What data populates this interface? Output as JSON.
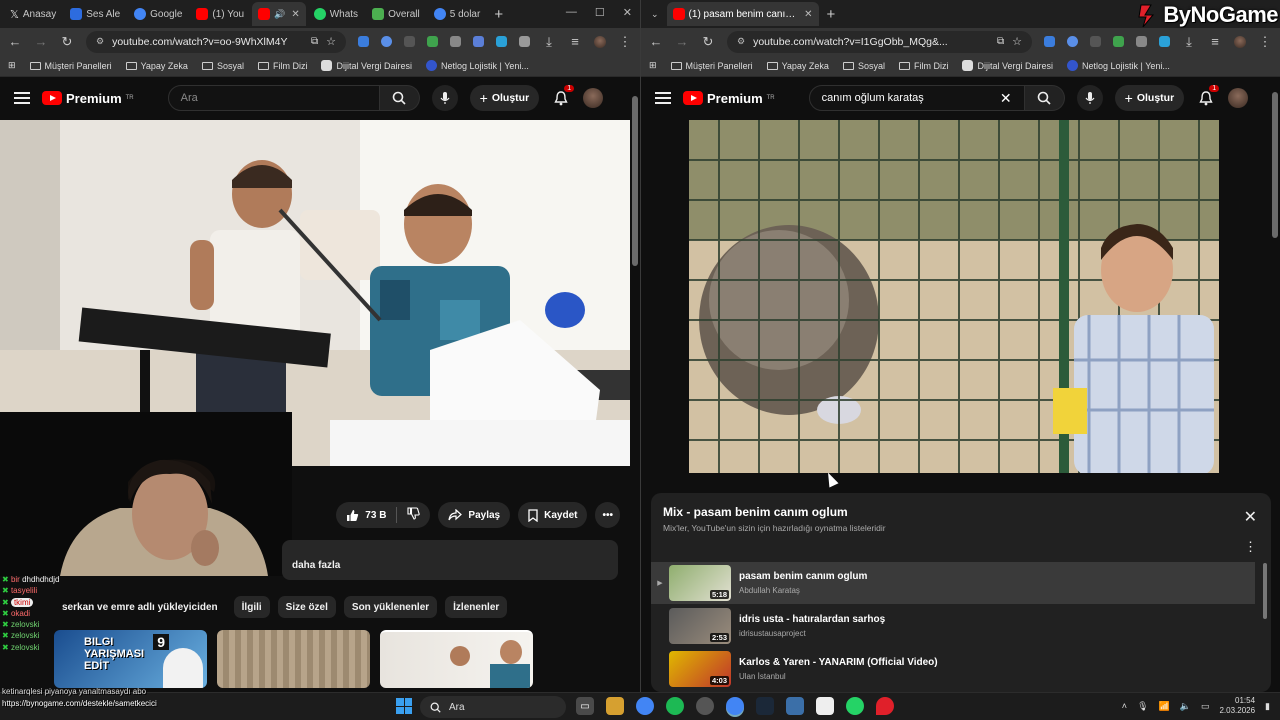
{
  "brand": {
    "text": "ByNoGame"
  },
  "left_browser": {
    "tabs": [
      {
        "label": "Anasay",
        "color": "#444"
      },
      {
        "label": "Ses Ale",
        "color": "#2d6cdf"
      },
      {
        "label": "Google",
        "color": "#4285f4"
      },
      {
        "label": "(1) You",
        "color": "#ff0000"
      },
      {
        "label": "",
        "color": "#ff0000"
      },
      {
        "label": "Whats",
        "color": "#25d366"
      },
      {
        "label": "Overall",
        "color": "#4caf50"
      },
      {
        "label": "5 dolar",
        "color": "#4285f4"
      }
    ],
    "url": "youtube.com/watch?v=oo-9WhXlM4Y",
    "bookmarks": [
      "Müşteri Panelleri",
      "Yapay Zeka",
      "Sosyal",
      "Film Dizi",
      "Dijital Vergi Dairesi",
      "Netlog Lojistik | Yeni..."
    ],
    "yt": {
      "logo": "Premium",
      "region": "TR",
      "search_placeholder": "Ara",
      "create_label": "Oluştur",
      "notif_count": "1"
    },
    "actions": {
      "likes": "73 B",
      "share": "Paylaş",
      "save": "Kaydet"
    },
    "desc_more": "daha fazla",
    "chips": [
      "serkan ve emre adlı yükleyiciden",
      "İlgili",
      "Size özel",
      "Son yüklenenler",
      "İzlenenler"
    ],
    "thumb1_text": "BILGI YARIŞMASI EDİT",
    "thumb1_num": "9"
  },
  "chat": {
    "lines": [
      {
        "user": "dhdhdhdjd",
        "text": ""
      },
      {
        "user": "tasyelili",
        "text": ""
      },
      {
        "user": "tkimi",
        "text": ""
      },
      {
        "user": "okadi",
        "text": ""
      },
      {
        "user": "zelovski",
        "text": ""
      },
      {
        "user": "zelovski",
        "text": ""
      },
      {
        "user": "zelovski",
        "text": ""
      }
    ],
    "ticker1": "ketinarqlesi piyanoya yanaltmasaydı abo",
    "ticker2": "https://bynogame.com/destekle/sametkecici"
  },
  "right_browser": {
    "tab_label": "(1) pasam benim canım oglum",
    "url": "youtube.com/watch?v=I1GgObb_MQg&...",
    "bookmarks": [
      "Müşteri Panelleri",
      "Yapay Zeka",
      "Sosyal",
      "Film Dizi",
      "Dijital Vergi Dairesi",
      "Netlog Lojistik | Yeni..."
    ],
    "yt": {
      "logo": "Premium",
      "region": "TR",
      "search_value": "canım oğlum karataş",
      "create_label": "Oluştur",
      "notif_count": "1"
    },
    "mix": {
      "title": "Mix - pasam benim canım oglum",
      "subtitle": "Mix'ler, YouTube'un sizin için hazırladığı oynatma listeleridir",
      "items": [
        {
          "title": "pasam benim canım oglum",
          "channel": "Abdullah Karataş",
          "duration": "5:18",
          "current": true
        },
        {
          "title": "idris usta - hatıralardan sarhoş",
          "channel": "idrisustausaproject",
          "duration": "2:53",
          "current": false
        },
        {
          "title": "Karlos & Yaren - YANARIM (Official Video)",
          "channel": "Ulan İstanbul",
          "duration": "4:03",
          "current": false
        }
      ]
    }
  },
  "taskbar": {
    "search_label": "Ara",
    "time": "01:54",
    "date": "2.03.2026"
  }
}
